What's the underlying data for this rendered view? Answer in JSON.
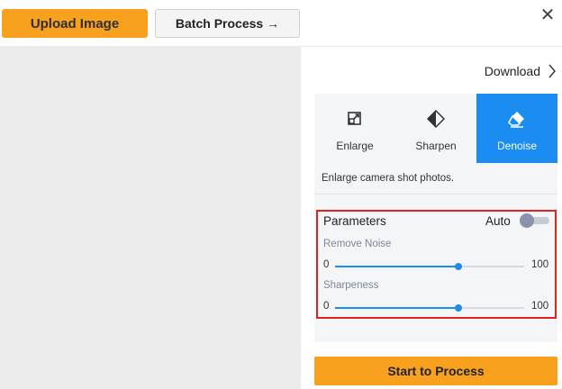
{
  "toolbar": {
    "upload_label": "Upload Image",
    "batch_label": "Batch Process →",
    "close_glyph": "✕"
  },
  "panel": {
    "download_label": "Download",
    "tabs": [
      {
        "label": "Enlarge",
        "icon": "enlarge-icon",
        "active": false
      },
      {
        "label": "Sharpen",
        "icon": "sharpen-icon",
        "active": false
      },
      {
        "label": "Denoise",
        "icon": "eraser-icon",
        "active": true
      }
    ],
    "description": "Enlarge camera shot photos.",
    "parameters": {
      "title": "Parameters",
      "auto_label": "Auto",
      "auto_on": false,
      "sliders": [
        {
          "label": "Remove Noise",
          "min": "0",
          "max": "100",
          "value": 65
        },
        {
          "label": "Sharpeness",
          "min": "0",
          "max": "100",
          "value": 65
        }
      ]
    },
    "start_label": "Start to Process"
  },
  "colors": {
    "accent_orange": "#f7a11e",
    "accent_blue": "#1b8cf2",
    "highlight_red": "#e02222"
  }
}
